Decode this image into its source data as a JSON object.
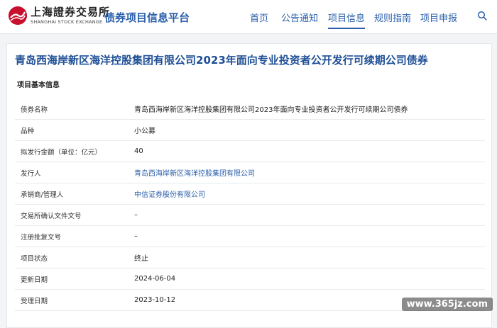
{
  "header": {
    "logo_cn": "上海證券交易所",
    "logo_en": "SHANGHAI STOCK EXCHANGE",
    "site_name": "债券项目信息平台",
    "nav": [
      {
        "label": "首页"
      },
      {
        "label": "公告通知"
      },
      {
        "label": "项目信息",
        "active": true
      },
      {
        "label": "规则指南"
      },
      {
        "label": "项目申报"
      }
    ],
    "icons": {
      "search": "search-icon",
      "logo": "sse-logo-icon"
    },
    "colors": {
      "brand_blue": "#2a5fab",
      "logo_red": "#c8102e"
    }
  },
  "main": {
    "title": "青岛西海岸新区海洋控股集团有限公司2023年面向专业投资者公开发行可续期公司债券",
    "section_title": "项目基本信息",
    "rows": [
      {
        "label": "债券名称",
        "value": "青岛西海岸新区海洋控股集团有限公司2023年面向专业投资者公开发行可续期公司债券"
      },
      {
        "label": "品种",
        "value": "小公募"
      },
      {
        "label": "拟发行金额（单位：亿元）",
        "value": "40"
      },
      {
        "label": "发行人",
        "value": "青岛西海岸新区海洋控股集团有限公司",
        "link": true
      },
      {
        "label": "承销商/管理人",
        "value": "中信证券股份有限公司",
        "link": true
      },
      {
        "label": "交易所确认文件文号",
        "value": "–"
      },
      {
        "label": "注册批复文号",
        "value": "–"
      },
      {
        "label": "项目状态",
        "value": "终止"
      },
      {
        "label": "更新日期",
        "value": "2024-06-04"
      },
      {
        "label": "受理日期",
        "value": "2023-10-12"
      }
    ]
  },
  "watermark": "www.365jz.com"
}
